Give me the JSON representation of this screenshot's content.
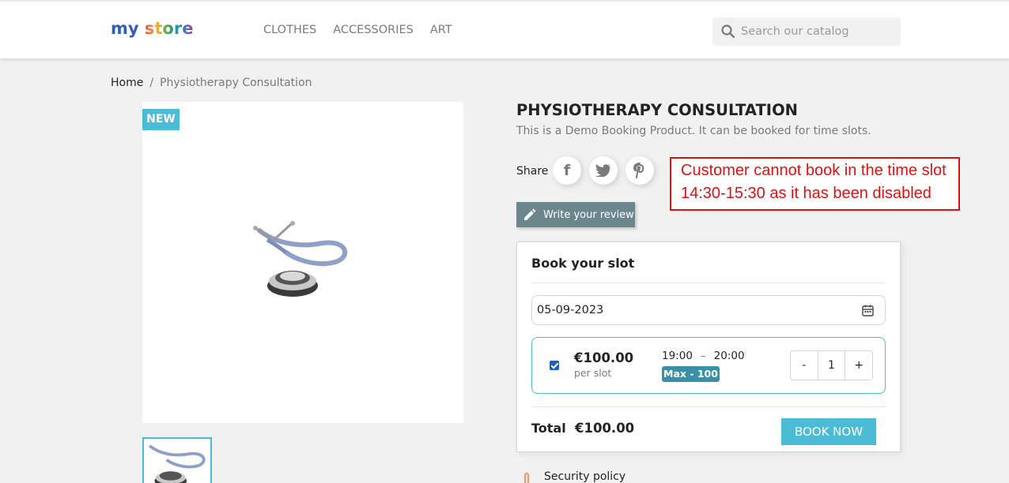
{
  "header": {
    "logo": {
      "word1": "my",
      "word2": "store",
      "colors": [
        "#e94c3d",
        "#2e88c8",
        "#f2b53a",
        "#3aa655",
        "#8e44ad"
      ]
    },
    "nav": [
      "CLOTHES",
      "ACCESSORIES",
      "ART"
    ],
    "search": {
      "placeholder": "Search our catalog",
      "icon": "search-icon"
    }
  },
  "breadcrumb": {
    "home": "Home",
    "separator": "/",
    "current": "Physiotherapy Consultation"
  },
  "product": {
    "badge": "NEW",
    "title": "PHYSIOTHERAPY CONSULTATION",
    "description": "This is a Demo Booking Product. It can be booked for time slots.",
    "share_label": "Share",
    "share_icons": [
      "facebook-icon",
      "twitter-icon",
      "pinterest-icon"
    ],
    "review_button": "Write your review"
  },
  "callout": {
    "line1": "Customer cannot book in the time slot",
    "line2": "14:30-15:30 as it has been disabled",
    "color": "#e01010"
  },
  "booking": {
    "title": "Book your slot",
    "date": "05-09-2023",
    "slot": {
      "checked": true,
      "price": "€100.00",
      "per_label": "per slot",
      "time_start": "19:00",
      "time_sep": "–",
      "time_end": "20:00",
      "max": "Max - 100",
      "quantity": "1",
      "minus": "-",
      "plus": "+"
    },
    "total_label": "Total",
    "total_value": "€100.00",
    "book_button": "BOOK NOW"
  },
  "footer_reassurance": {
    "security": "Security policy"
  },
  "colors": {
    "accent": "#4cbbd5",
    "review_button": "#6c868e",
    "max_badge": "#3a90a8"
  }
}
